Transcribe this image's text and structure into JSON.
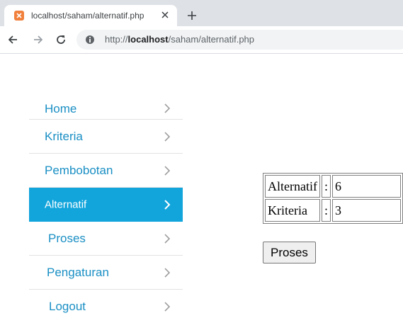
{
  "browser": {
    "tab_title": "localhost/saham/alternatif.php",
    "url_prefix": "http://",
    "url_host": "localhost",
    "url_path": "/saham/alternatif.php"
  },
  "sidebar": {
    "items": [
      {
        "label": "Home"
      },
      {
        "label": "Kriteria"
      },
      {
        "label": "Pembobotan"
      },
      {
        "label": "Alternatif"
      },
      {
        "label": "Proses"
      },
      {
        "label": "Pengaturan"
      },
      {
        "label": "Logout"
      }
    ],
    "active_index": 3
  },
  "info_table": {
    "rows": [
      {
        "label": "Alternatif",
        "sep": ":",
        "value": "6"
      },
      {
        "label": "Kriteria",
        "sep": ":",
        "value": "3"
      }
    ]
  },
  "proses_button_label": "Proses",
  "colors": {
    "active_bg": "#11a5dc",
    "menu_text": "#1a8fc4"
  },
  "icons": [
    "favicon-icon",
    "close-icon",
    "plus-icon",
    "back-arrow-icon",
    "forward-arrow-icon",
    "reload-icon",
    "site-info-icon",
    "chevron-right-icon"
  ]
}
